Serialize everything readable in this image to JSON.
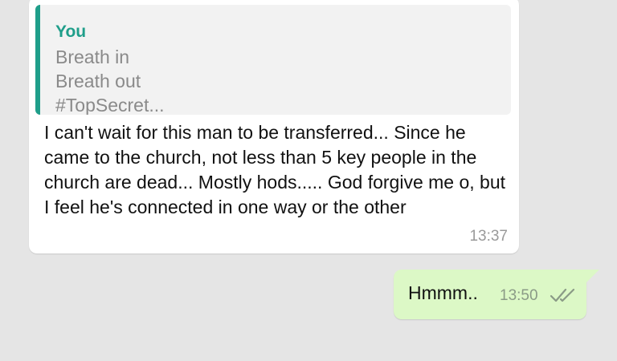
{
  "incoming": {
    "quote": {
      "author": "You",
      "lines": [
        "Breath in",
        "Breath out",
        "#TopSecret..."
      ]
    },
    "text": "I can't wait for this man to be transferred... Since he came to the church, not less than 5 key people in the church are dead... Mostly hods..... God forgive me o, but I feel he's connected in one way or the other",
    "time": "13:37"
  },
  "outgoing": {
    "text": "Hmmm..",
    "time": "13:50",
    "status_icon": "double-check-icon"
  },
  "colors": {
    "background": "#e5e5e5",
    "incoming_bubble": "#ffffff",
    "outgoing_bubble": "#dcf8c6",
    "quote_accent": "#1f9e8a"
  }
}
